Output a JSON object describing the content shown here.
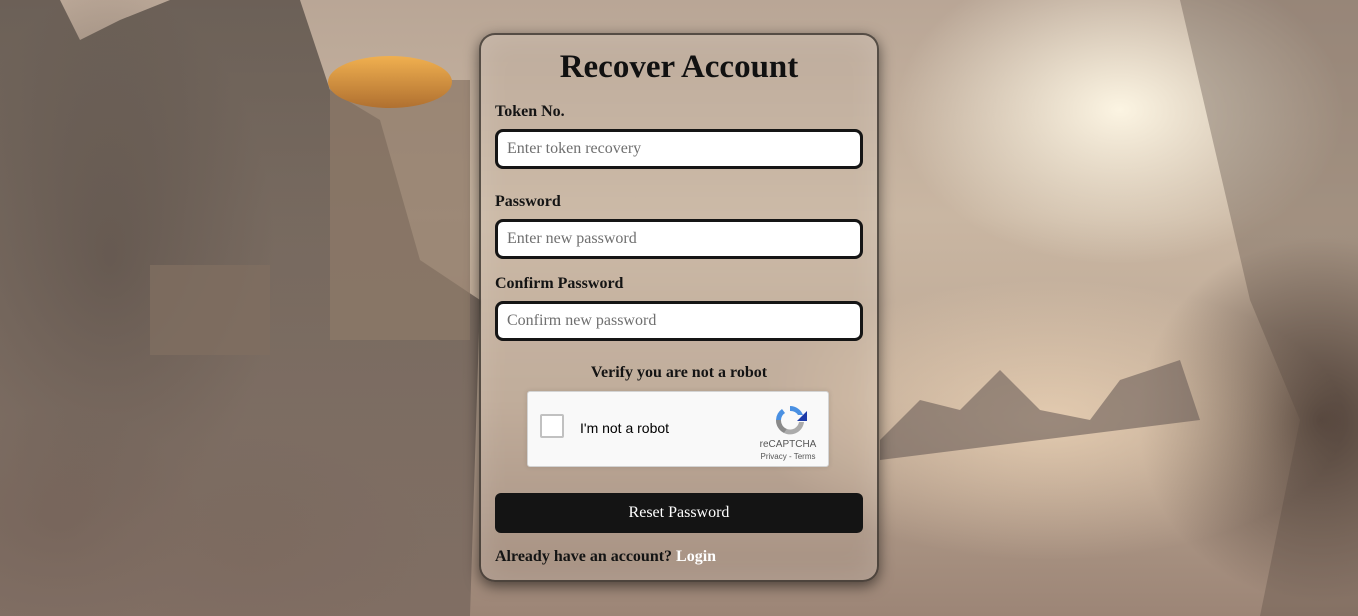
{
  "title": "Recover Account",
  "token_field": {
    "label": "Token No.",
    "placeholder": "Enter token recovery"
  },
  "password_field": {
    "label": "Password",
    "placeholder": "Enter new password"
  },
  "confirm_field": {
    "label": "Confirm Password",
    "placeholder": "Confirm new password"
  },
  "captcha": {
    "prompt": "Verify you are not a robot",
    "checkbox_label": "I'm not a robot",
    "brand": "reCAPTCHA",
    "privacy_link": "Privacy",
    "separator": " - ",
    "terms_link": "Terms",
    "icon": "recaptcha-logo"
  },
  "reset_button": "Reset Password",
  "footer": {
    "prompt": "Already have an account?",
    "login_link": "Login"
  },
  "colors": {
    "button_bg": "#141414",
    "input_border": "#151515",
    "link": "#ffffff"
  }
}
